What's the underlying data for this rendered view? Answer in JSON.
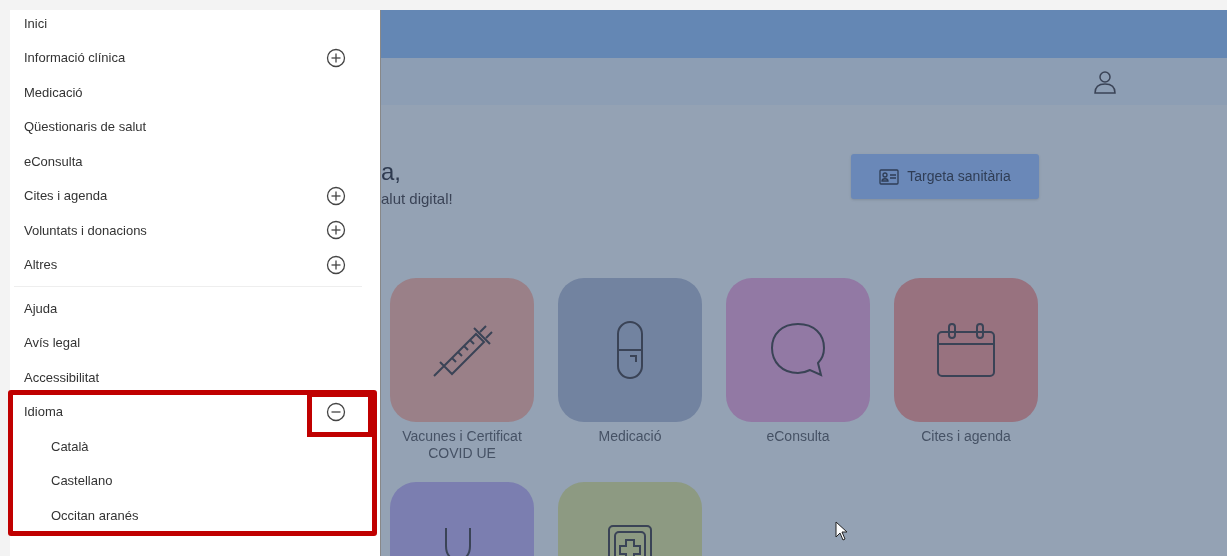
{
  "sidebar": {
    "main_items": [
      {
        "label": "Inici",
        "kind": "link"
      },
      {
        "label": "Informació clínica",
        "kind": "group",
        "expanded": false
      },
      {
        "label": "Medicació",
        "kind": "link"
      },
      {
        "label": "Qüestionaris de salut",
        "kind": "link"
      },
      {
        "label": "eConsulta",
        "kind": "link"
      },
      {
        "label": "Cites i agenda",
        "kind": "group",
        "expanded": false
      },
      {
        "label": "Voluntats i donacions",
        "kind": "group",
        "expanded": false
      },
      {
        "label": "Altres",
        "kind": "group",
        "expanded": false
      }
    ],
    "secondary_items": [
      {
        "label": "Ajuda",
        "kind": "link"
      },
      {
        "label": "Avís legal",
        "kind": "link"
      },
      {
        "label": "Accessibilitat",
        "kind": "link"
      },
      {
        "label": "Idioma",
        "kind": "group",
        "expanded": true,
        "children": [
          {
            "label": "Català"
          },
          {
            "label": "Castellano"
          },
          {
            "label": "Occitan aranés"
          }
        ]
      }
    ]
  },
  "greeting": {
    "title": "a,",
    "subtitle": "alut digital!"
  },
  "health_card_button": "Targeta sanitària",
  "tiles": [
    {
      "label": "Vacunes i Certificat COVID UE",
      "color": "#9a8088"
    },
    {
      "label": "Medicació",
      "color": "#7283a0"
    },
    {
      "label": "eConsulta",
      "color": "#9279a4"
    },
    {
      "label": "Cites i agenda",
      "color": "#98727f"
    },
    {
      "color": "#7b7eb0"
    },
    {
      "color": "#8d9a82"
    }
  ]
}
